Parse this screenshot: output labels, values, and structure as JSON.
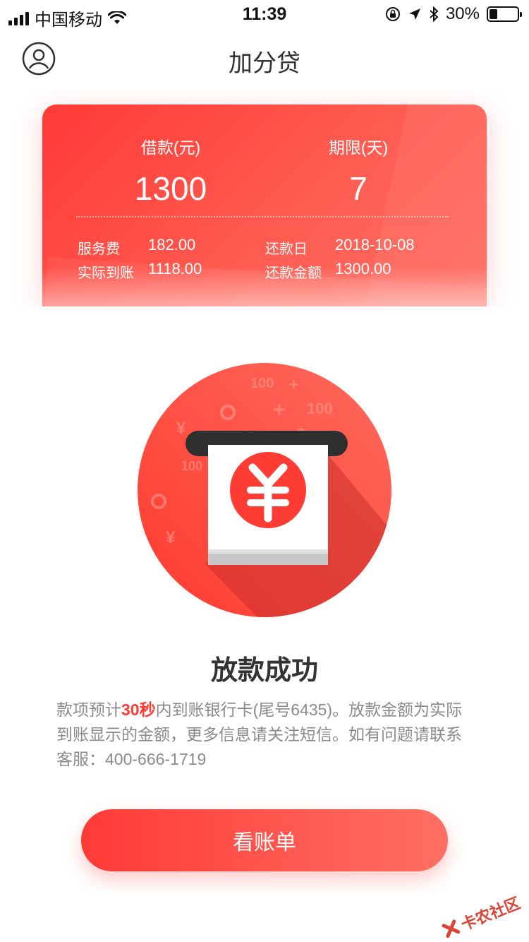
{
  "status_bar": {
    "carrier": "中国移动",
    "time": "11:39",
    "battery_percent": "30%",
    "battery_level": 0.3,
    "icons": [
      "signal-icon",
      "wifi-icon",
      "orientation-lock-icon",
      "location-icon",
      "bluetooth-icon",
      "battery-icon"
    ]
  },
  "nav": {
    "title": "加分贷",
    "profile_icon": "user-circle-icon"
  },
  "loan_card": {
    "loan_label": "借款(元)",
    "loan_value": "1300",
    "term_label": "期限(天)",
    "term_value": "7",
    "details": [
      {
        "label": "服务费",
        "value": "182.00"
      },
      {
        "label": "实际到账",
        "value": "1118.00"
      },
      {
        "label": "还款日",
        "value": "2018-10-08"
      },
      {
        "label": "还款金额",
        "value": "1300.00"
      }
    ]
  },
  "illustration": {
    "icon": "yuan-coin-icon",
    "bg_marks": [
      "100",
      "+",
      "¥",
      "100",
      "+",
      "¥",
      "100"
    ]
  },
  "result": {
    "title": "放款成功",
    "desc_prefix": "款项预计",
    "desc_highlight": "30秒",
    "desc_rest": "内到账银行卡(尾号6435)。放款金额为实际到账显示的金额，更多信息请关注短信。如有问题请联系客服：400-666-1719"
  },
  "actions": {
    "view_bill": "看账单"
  },
  "watermark": {
    "text": "卡农社区"
  },
  "colors": {
    "accent": "#ff3a36",
    "accent_light": "#ff6f63",
    "text_primary": "#333333",
    "text_secondary": "#8a8a8a"
  }
}
